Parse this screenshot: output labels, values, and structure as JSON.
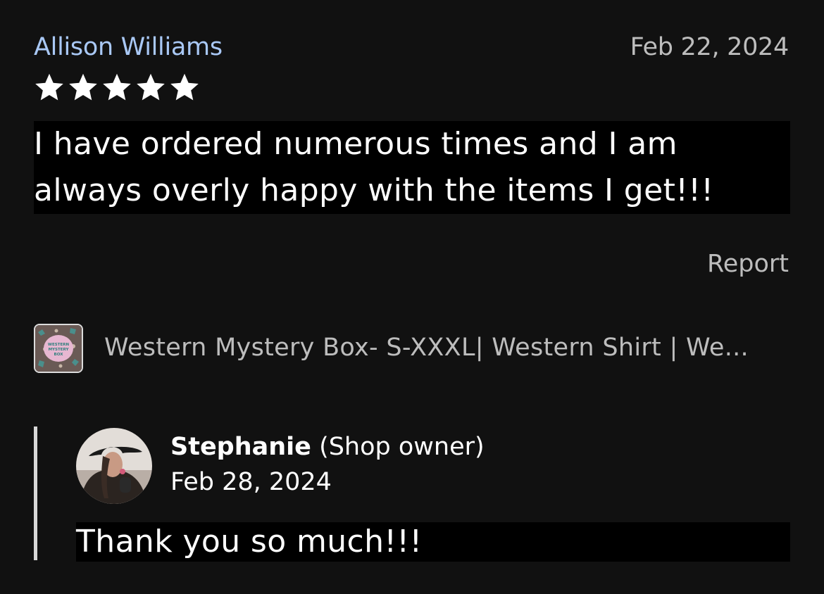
{
  "review": {
    "reviewer_name": "Allison Williams",
    "date": "Feb 22, 2024",
    "rating": 5,
    "rating_max": 5,
    "text": "I have ordered numerous times and I am always overly happy with the items I get!!!",
    "report_label": "Report"
  },
  "product": {
    "title": "Western Mystery Box- S-XXXL| Western Shirt | We...",
    "thumbnail_text": "WESTERN MYSTERY BOX"
  },
  "reply": {
    "owner_name": "Stephanie",
    "owner_role": "(Shop owner)",
    "date": "Feb 28, 2024",
    "text": "Thank you so much!!!"
  },
  "colors": {
    "background": "#111111",
    "reviewer_name": "#a9c8f5",
    "muted_text": "#bdbdbd",
    "text_highlight_bg": "#000000"
  }
}
